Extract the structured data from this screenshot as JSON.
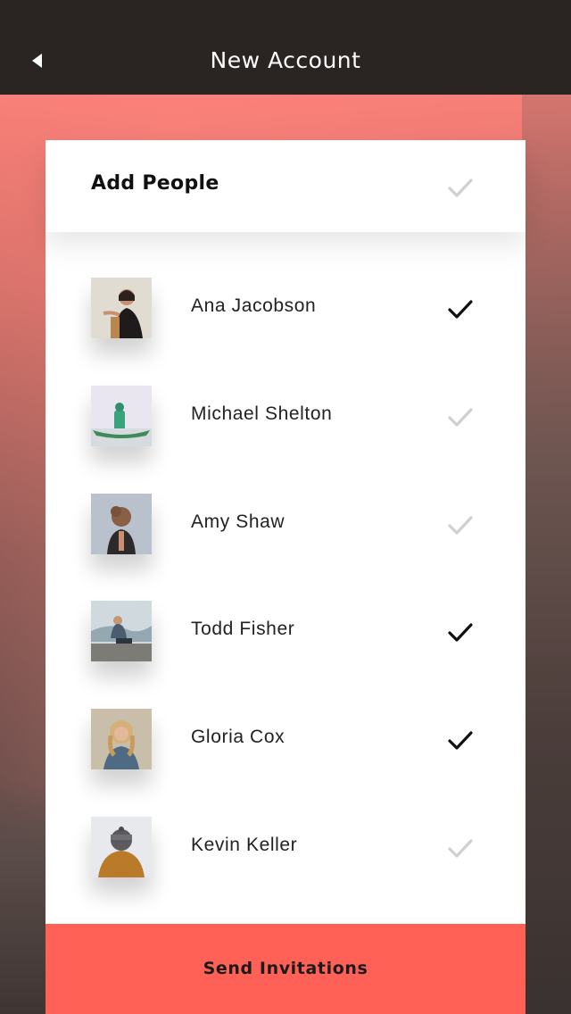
{
  "header": {
    "title": "New Account",
    "back_icon": "back-arrow-icon"
  },
  "card": {
    "title": "Add People",
    "all_selected": false
  },
  "people": [
    {
      "name": "Ana Jacobson",
      "selected": true,
      "avatar": "woman-portrait"
    },
    {
      "name": "Michael Shelton",
      "selected": false,
      "avatar": "man-in-canoe"
    },
    {
      "name": "Amy Shaw",
      "selected": false,
      "avatar": "woman-from-behind"
    },
    {
      "name": "Todd Fisher",
      "selected": true,
      "avatar": "man-sitting-on-rock"
    },
    {
      "name": "Gloria Cox",
      "selected": true,
      "avatar": "woman-curly-hair"
    },
    {
      "name": "Kevin Keller",
      "selected": false,
      "avatar": "person-in-hood"
    }
  ],
  "action": {
    "send_label": "Send Invitations"
  },
  "colors": {
    "header_bg": "#2a2422",
    "accent": "#ff6157",
    "check_on": "#111111",
    "check_off": "#cfcfcf"
  }
}
